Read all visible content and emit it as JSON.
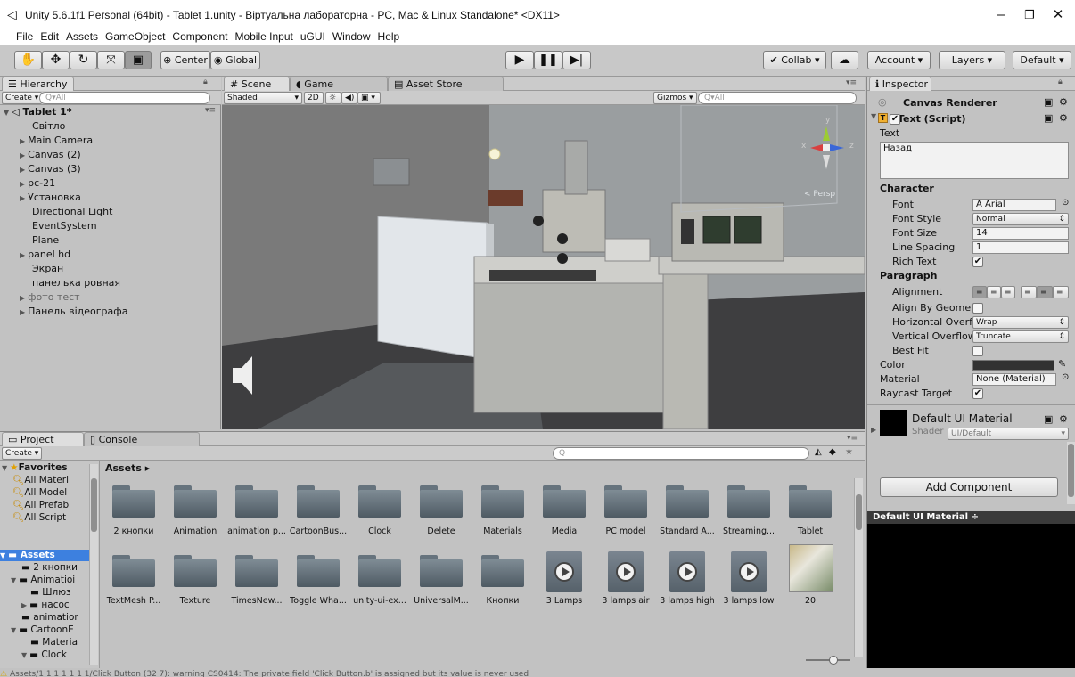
{
  "window": {
    "title": "Unity 5.6.1f1 Personal (64bit) - Tablet 1.unity - Віртуальна лабораторна - PC, Mac & Linux Standalone* <DX11>",
    "minimize": "–",
    "maximize": "❐",
    "close": "✕"
  },
  "menu": [
    "File",
    "Edit",
    "Assets",
    "GameObject",
    "Component",
    "Mobile Input",
    "uGUI",
    "Window",
    "Help"
  ],
  "toolbar": {
    "pivot": "Center",
    "space": "Global",
    "collab": "Collab",
    "account": "Account",
    "layers": "Layers",
    "layout": "Default"
  },
  "hierarchy": {
    "tab": "Hierarchy",
    "create": "Create",
    "search_placeholder": "Q▾All",
    "scene_name": "Tablet 1*",
    "items": [
      "Світло",
      "Main Camera",
      "Canvas (2)",
      "Canvas (3)",
      "pc-21",
      "Установка",
      "Directional Light",
      "EventSystem",
      "Plane",
      "panel hd",
      "Экран",
      "панелька ровная",
      "фото тест",
      "Панель відеографа"
    ]
  },
  "scene": {
    "tabs": [
      "Scene",
      "Game",
      "Asset Store"
    ],
    "shading": "Shaded",
    "mode_2d": "2D",
    "gizmos": "Gizmos",
    "search_placeholder": "Q▾All",
    "persp": "< Persp",
    "axis_y": "y",
    "axis_x": "x",
    "axis_z": "z"
  },
  "project": {
    "tabs": [
      "Project",
      "Console"
    ],
    "create": "Create",
    "search_placeholder": "Q",
    "favorites_label": "Favorites",
    "favorites": [
      "All Materi",
      "All Model",
      "All Prefab",
      "All Script"
    ],
    "assets_label": "Assets",
    "tree": [
      "2 кнопки",
      "Animatioi",
      "Шлюз",
      "насос",
      "animatior",
      "CartoonE",
      "Materia",
      "Clock"
    ],
    "breadcrumb": "Assets ▸",
    "row1": [
      "2 кнопки",
      "Animation",
      "animation p...",
      "CartoonBus...",
      "Clock",
      "Delete",
      "Materials",
      "Media",
      "PC model",
      "Standard A...",
      "Streaming...",
      "Tablet"
    ],
    "row2": [
      "TextMesh P...",
      "Texture",
      "TimesNew...",
      "Toggle Wha...",
      "unity-ui-ex...",
      "UniversalM...",
      "Кнопки",
      "3 Lamps",
      "3 lamps air",
      "3 lamps high",
      "3 lamps low",
      "20"
    ]
  },
  "inspector": {
    "tab": "Inspector",
    "canvas_renderer": "Canvas Renderer",
    "text_script": "Text (Script)",
    "text_label": "Text",
    "text_value": "Назад",
    "character": "Character",
    "font_label": "Font",
    "font_value": "Arial",
    "font_style_label": "Font Style",
    "font_style_value": "Normal",
    "font_size_label": "Font Size",
    "font_size_value": "14",
    "line_spacing_label": "Line Spacing",
    "line_spacing_value": "1",
    "rich_text_label": "Rich Text",
    "paragraph": "Paragraph",
    "alignment_label": "Alignment",
    "align_by_geom_label": "Align By Geometr",
    "horiz_overflow_label": "Horizontal Overflo",
    "horiz_overflow_value": "Wrap",
    "vert_overflow_label": "Vertical Overflow",
    "vert_overflow_value": "Truncate",
    "best_fit_label": "Best Fit",
    "color_label": "Color",
    "material_label": "Material",
    "material_value": "None (Material)",
    "raycast_label": "Raycast Target",
    "default_material": "Default UI Material",
    "shader_label": "Shader",
    "shader_value": "UI/Default",
    "add_component": "Add Component",
    "preview_title": "Default UI Material ÷"
  },
  "status": {
    "text": "Assets/1 1 1 1 1 1 1/Click Button (32 7): warning CS0414: The private field 'Click Button.b' is assigned but its value is never used"
  },
  "colors": {
    "editor_bg": "#c2c2c2",
    "selected": "#3d80df",
    "scene_sky": "#5f5f5f"
  }
}
